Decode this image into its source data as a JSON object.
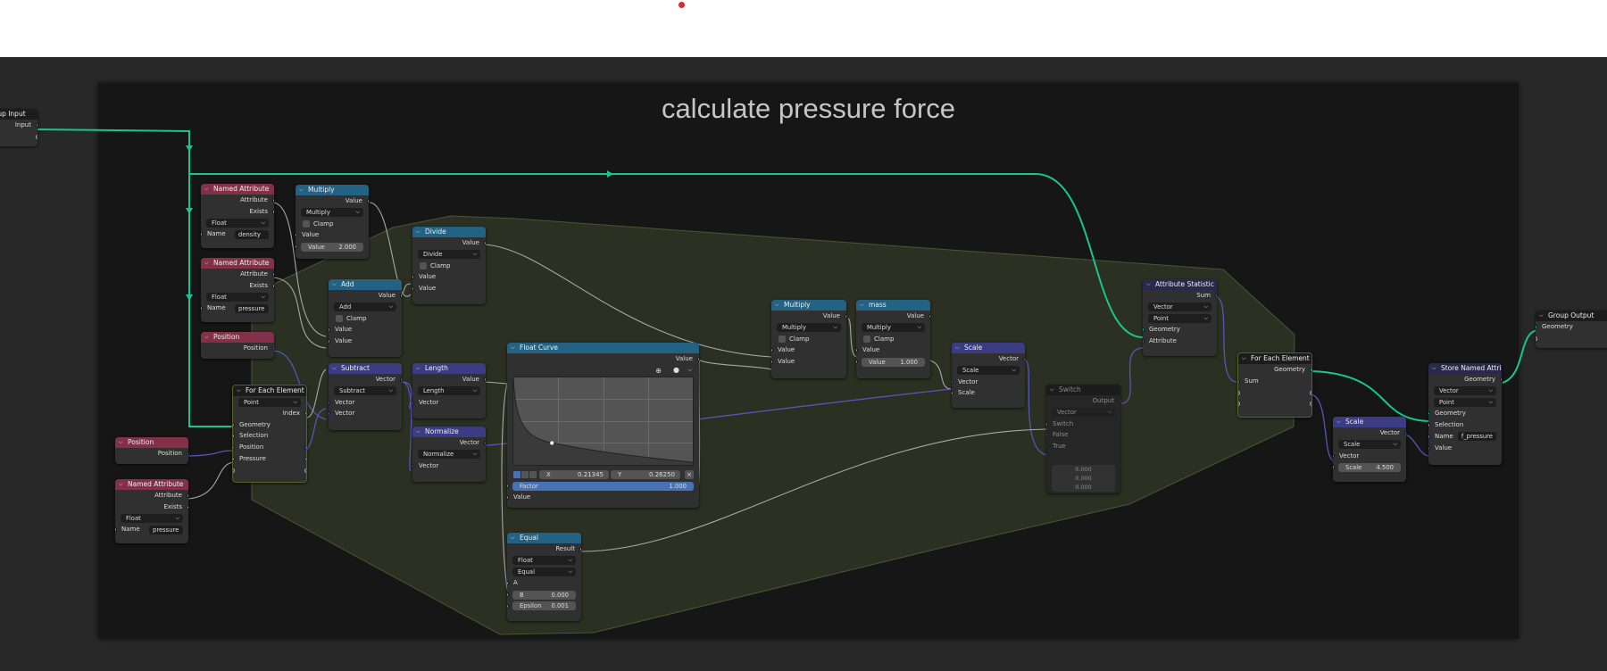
{
  "frame": {
    "title": "calculate pressure force"
  },
  "group_input": {
    "title": "Group Input",
    "socket": "Input"
  },
  "group_output": {
    "title": "Group Output",
    "socket": "Geometry"
  },
  "named_attr_density": {
    "title": "Named Attribute",
    "out1": "Attribute",
    "out2": "Exists",
    "type": "Float",
    "name_label": "Name",
    "name_value": "density"
  },
  "named_attr_pressure_top": {
    "title": "Named Attribute",
    "out1": "Attribute",
    "out2": "Exists",
    "type": "Float",
    "name_label": "Name",
    "name_value": "pressure"
  },
  "named_attr_pressure_low": {
    "title": "Named Attribute",
    "out1": "Attribute",
    "out2": "Exists",
    "type": "Float",
    "name_label": "Name",
    "name_value": "pressure"
  },
  "position_a": {
    "title": "Position",
    "out": "Position"
  },
  "position_b": {
    "title": "Position",
    "out": "Position"
  },
  "multiply_1": {
    "title": "Multiply",
    "out": "Value",
    "op": "Multiply",
    "clamp": "Clamp",
    "in": "Value",
    "field_k": "Value",
    "field_v": "2.000"
  },
  "divide": {
    "title": "Divide",
    "out": "Value",
    "op": "Divide",
    "clamp": "Clamp",
    "in1": "Value",
    "in2": "Value"
  },
  "add": {
    "title": "Add",
    "out": "Value",
    "op": "Add",
    "clamp": "Clamp",
    "in1": "Value",
    "in2": "Value"
  },
  "subtract": {
    "title": "Subtract",
    "out": "Vector",
    "op": "Subtract",
    "in1": "Vector",
    "in2": "Vector"
  },
  "length": {
    "title": "Length",
    "out": "Value",
    "op": "Length",
    "in": "Vector"
  },
  "normalize": {
    "title": "Normalize",
    "out": "Vector",
    "op": "Normalize",
    "in": "Vector"
  },
  "foreach_1": {
    "title": "For Each Element",
    "domain": "Point",
    "out": "Index",
    "in1": "Geometry",
    "in2": "Selection",
    "in3": "Position",
    "in4": "Pressure"
  },
  "float_curve": {
    "title": "Float Curve",
    "out": "Value",
    "x_label": "X",
    "x_value": "0.21345",
    "y_label": "Y",
    "y_value": "0.26250",
    "factor_label": "Factor",
    "factor_value": "1.000",
    "in": "Value"
  },
  "equal": {
    "title": "Equal",
    "out": "Result",
    "type": "Float",
    "op": "Equal",
    "a": "A",
    "b_label": "B",
    "b_value": "0.000",
    "eps_label": "Epsilon",
    "eps_value": "0.001"
  },
  "multiply_2": {
    "title": "Multiply",
    "out": "Value",
    "op": "Multiply",
    "clamp": "Clamp",
    "in1": "Value",
    "in2": "Value"
  },
  "mass": {
    "title": "mass",
    "out": "Value",
    "op": "Multiply",
    "clamp": "Clamp",
    "in": "Value",
    "field_k": "Value",
    "field_v": "1.000"
  },
  "scale_1": {
    "title": "Scale",
    "out": "Vector",
    "op": "Scale",
    "in1": "Vector",
    "in2": "Scale"
  },
  "switch": {
    "title": "Switch",
    "out": "Output",
    "type": "Vector",
    "in1": "Switch",
    "in2": "False",
    "in3": "True",
    "v1": "0.000",
    "v2": "0.000",
    "v3": "0.000"
  },
  "attr_stat": {
    "title": "Attribute Statistic",
    "out": "Sum",
    "type": "Vector",
    "domain": "Point",
    "in1": "Geometry",
    "in2": "Attribute"
  },
  "foreach_2": {
    "title": "For Each Element",
    "out": "Geometry",
    "in": "Sum"
  },
  "scale_2": {
    "title": "Scale",
    "out": "Vector",
    "op": "Scale",
    "in": "Vector",
    "field_k": "Scale",
    "field_v": "4.500"
  },
  "store_attr": {
    "title": "Store Named Attrib...",
    "out": "Geometry",
    "type": "Vector",
    "domain": "Point",
    "in1": "Geometry",
    "in2": "Selection",
    "name_label": "Name",
    "name_value": "f_pressure",
    "in4": "Value"
  }
}
